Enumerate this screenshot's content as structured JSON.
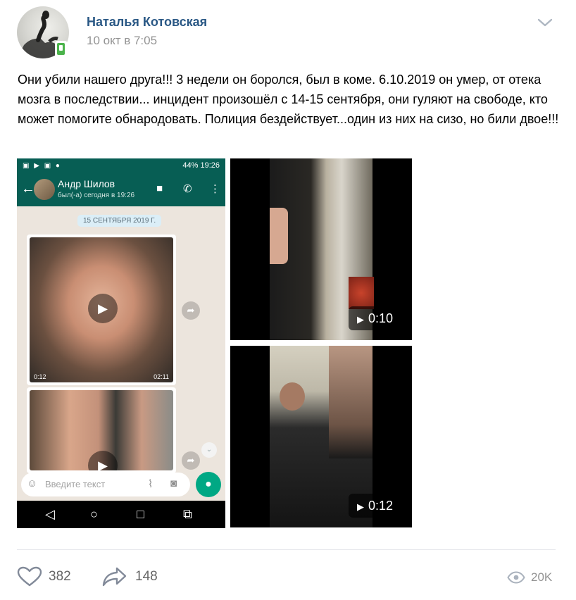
{
  "post": {
    "author": "Наталья Котовская",
    "date": "10 окт в 7:05",
    "text": "Они убили нашего друга!!! 3 недели он боролся, был в коме. 6.10.2019 он умер, от отека мозга в последствии... инцидент произошёл с 14-15 сентября, они гуляют на свободе, кто может помогите обнародовать. Полиция бездействует...один из них на сизо, но били двое!!!"
  },
  "attachments": {
    "phone": {
      "status_battery": "44% 19:26",
      "contact_name": "Андр Шилов",
      "contact_seen": "был(-а) сегодня в 19:26",
      "date_chip": "15 СЕНТЯБРЯ 2019 Г.",
      "video1_duration": "0:12",
      "video1_time": "02:11",
      "input_placeholder": "Введите текст"
    },
    "video1_duration": "0:10",
    "video2_duration": "0:12"
  },
  "footer": {
    "likes": "382",
    "shares": "148",
    "views": "20K"
  },
  "colors": {
    "author_link": "#2a5885",
    "meta_gray": "#939393",
    "action_gray": "#656565",
    "whatsapp_green": "#075e54",
    "online_green": "#4bb34b"
  },
  "icons": [
    "phone-online-icon",
    "chevron-down-icon",
    "play-icon",
    "heart-icon",
    "share-icon",
    "eye-icon"
  ]
}
